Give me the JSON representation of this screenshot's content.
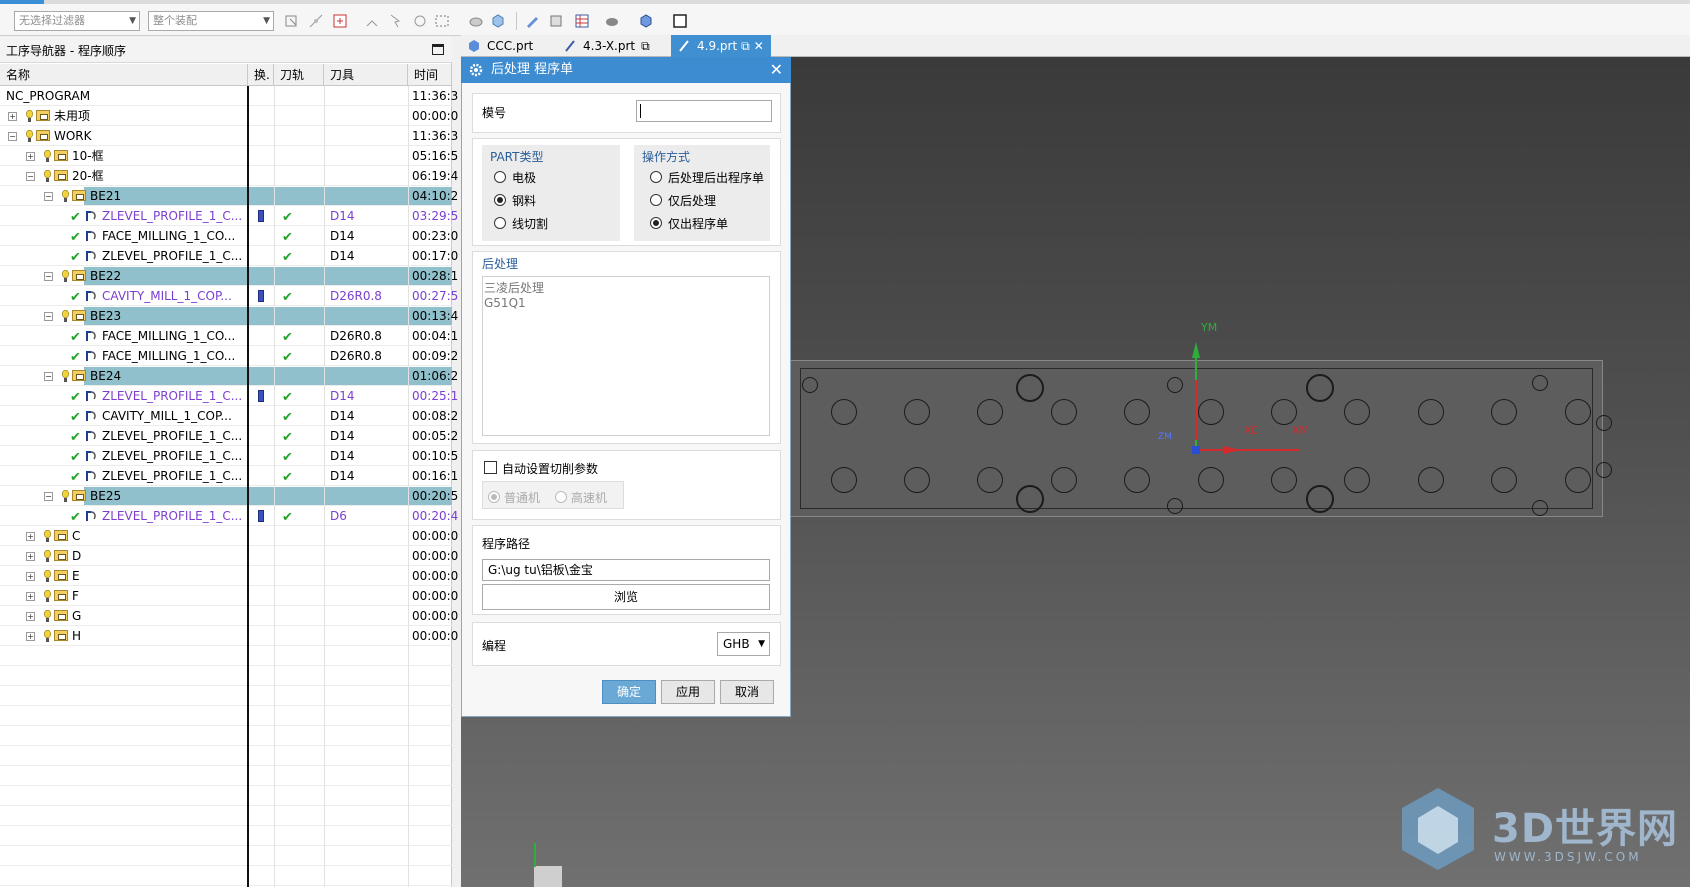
{
  "toolbar": {
    "filter_placeholder": "无选择过滤器",
    "assembly_placeholder": "整个装配"
  },
  "navigator": {
    "title": "工序导航器 - 程序顺序",
    "columns": [
      "名称",
      "换.",
      "刀轨",
      "刀具",
      "时间"
    ],
    "rows": [
      {
        "name": "NC_PROGRAM",
        "tool": "",
        "time": "11:36:3",
        "level": 0,
        "kind": "root"
      },
      {
        "name": "未用项",
        "tool": "",
        "time": "00:00:0",
        "level": 1,
        "kind": "folder",
        "expand": "+"
      },
      {
        "name": "WORK",
        "tool": "",
        "time": "11:36:3",
        "level": 1,
        "kind": "folder",
        "expand": "-"
      },
      {
        "name": "10-框",
        "tool": "",
        "time": "05:16:5",
        "level": 2,
        "kind": "folder",
        "expand": "+"
      },
      {
        "name": "20-框",
        "tool": "",
        "time": "06:19:4",
        "level": 2,
        "kind": "folder",
        "expand": "-"
      },
      {
        "name": "BE21",
        "tool": "",
        "time": "04:10:2",
        "level": 3,
        "kind": "folder",
        "expand": "-",
        "hl": true
      },
      {
        "name": "ZLEVEL_PROFILE_1_C...",
        "tool": "D14",
        "time": "03:29:5",
        "level": 4,
        "kind": "op",
        "purple": true,
        "tc": true
      },
      {
        "name": "FACE_MILLING_1_CO...",
        "tool": "D14",
        "time": "00:23:0",
        "level": 4,
        "kind": "op"
      },
      {
        "name": "ZLEVEL_PROFILE_1_C...",
        "tool": "D14",
        "time": "00:17:0",
        "level": 4,
        "kind": "op"
      },
      {
        "name": "BE22",
        "tool": "",
        "time": "00:28:1",
        "level": 3,
        "kind": "folder",
        "expand": "-",
        "hl": true
      },
      {
        "name": "CAVITY_MILL_1_COP...",
        "tool": "D26R0.8",
        "time": "00:27:5",
        "level": 4,
        "kind": "op",
        "purple": true,
        "tc": true
      },
      {
        "name": "BE23",
        "tool": "",
        "time": "00:13:4",
        "level": 3,
        "kind": "folder",
        "expand": "-",
        "hl": true
      },
      {
        "name": "FACE_MILLING_1_CO...",
        "tool": "D26R0.8",
        "time": "00:04:1",
        "level": 4,
        "kind": "op"
      },
      {
        "name": "FACE_MILLING_1_CO...",
        "tool": "D26R0.8",
        "time": "00:09:2",
        "level": 4,
        "kind": "op"
      },
      {
        "name": "BE24",
        "tool": "",
        "time": "01:06:2",
        "level": 3,
        "kind": "folder",
        "expand": "-",
        "hl": true
      },
      {
        "name": "ZLEVEL_PROFILE_1_C...",
        "tool": "D14",
        "time": "00:25:1",
        "level": 4,
        "kind": "op",
        "purple": true,
        "tc": true
      },
      {
        "name": "CAVITY_MILL_1_COP...",
        "tool": "D14",
        "time": "00:08:2",
        "level": 4,
        "kind": "op"
      },
      {
        "name": "ZLEVEL_PROFILE_1_C...",
        "tool": "D14",
        "time": "00:05:2",
        "level": 4,
        "kind": "op"
      },
      {
        "name": "ZLEVEL_PROFILE_1_C...",
        "tool": "D14",
        "time": "00:10:5",
        "level": 4,
        "kind": "op"
      },
      {
        "name": "ZLEVEL_PROFILE_1_C...",
        "tool": "D14",
        "time": "00:16:1",
        "level": 4,
        "kind": "op"
      },
      {
        "name": "BE25",
        "tool": "",
        "time": "00:20:5",
        "level": 3,
        "kind": "folder",
        "expand": "-",
        "hl": true
      },
      {
        "name": "ZLEVEL_PROFILE_1_C...",
        "tool": "D6",
        "time": "00:20:4",
        "level": 4,
        "kind": "op",
        "purple": true,
        "tc": true
      },
      {
        "name": "C",
        "tool": "",
        "time": "00:00:0",
        "level": 2,
        "kind": "folder",
        "expand": "+"
      },
      {
        "name": "D",
        "tool": "",
        "time": "00:00:0",
        "level": 2,
        "kind": "folder",
        "expand": "+"
      },
      {
        "name": "E",
        "tool": "",
        "time": "00:00:0",
        "level": 2,
        "kind": "folder",
        "expand": "+"
      },
      {
        "name": "F",
        "tool": "",
        "time": "00:00:0",
        "level": 2,
        "kind": "folder",
        "expand": "+"
      },
      {
        "name": "G",
        "tool": "",
        "time": "00:00:0",
        "level": 2,
        "kind": "folder",
        "expand": "+"
      },
      {
        "name": "H",
        "tool": "",
        "time": "00:00:0",
        "level": 2,
        "kind": "folder",
        "expand": "+"
      }
    ]
  },
  "tabs": [
    {
      "label": "CCC.prt",
      "active": false
    },
    {
      "label": "4.3-X.prt",
      "active": false
    },
    {
      "label": "4.9.prt",
      "active": true
    }
  ],
  "dialog": {
    "title": "后处理 程序单",
    "model_label": "模号",
    "model_value": "",
    "part_type_title": "PART类型",
    "part_types": [
      {
        "label": "电极",
        "selected": false
      },
      {
        "label": "钢料",
        "selected": true
      },
      {
        "label": "线切割",
        "selected": false
      }
    ],
    "op_mode_title": "操作方式",
    "op_modes": [
      {
        "label": "后处理后出程序单",
        "selected": false
      },
      {
        "label": "仅后处理",
        "selected": false
      },
      {
        "label": "仅出程序单",
        "selected": true
      }
    ],
    "post_title": "后处理",
    "post_items": [
      "三凌后处理",
      "G51Q1"
    ],
    "auto_cut_label": "自动设置切削参数",
    "auto_cut_checked": false,
    "machine_types": [
      {
        "label": "普通机",
        "selected": true
      },
      {
        "label": "高速机",
        "selected": false
      }
    ],
    "path_title": "程序路径",
    "path_value": "G:\\ug tu\\铝板\\金宝",
    "browse_label": "浏览",
    "programmer_label": "编程",
    "programmer_value": "GHB",
    "ok_label": "确定",
    "apply_label": "应用",
    "cancel_label": "取消"
  },
  "viewport": {
    "axis_ym": "YM",
    "axis_xc": "XC",
    "axis_xm": "XM",
    "axis_zm": "ZM"
  },
  "watermark": {
    "text": "3D世界网",
    "url": "WWW.3DSJW.COM"
  },
  "colors": {
    "accent": "#3d8bd0",
    "highlight_row": "#8fc0cc",
    "check": "#22a32a",
    "purple_text": "#7b3fd1"
  }
}
